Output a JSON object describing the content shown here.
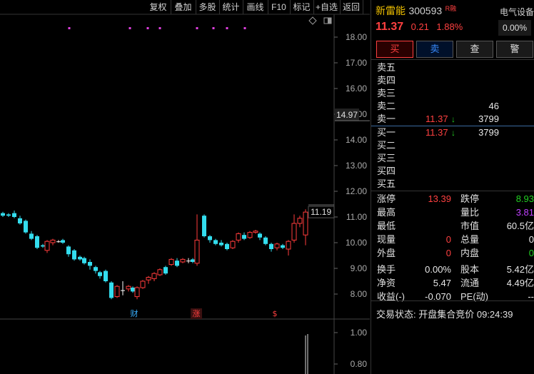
{
  "toolbar": {
    "items": [
      "复权",
      "叠加",
      "多股",
      "统计",
      "画线",
      "F10",
      "标记",
      "+自选",
      "返回"
    ]
  },
  "chart": {
    "price_ticks": [
      "18.00",
      "17.00",
      "16.00",
      "15.00",
      "14.00",
      "13.00",
      "12.00",
      "11.00",
      "10.00",
      "9.00",
      "8.00"
    ],
    "volume_ticks": [
      "1.00",
      "0.80"
    ],
    "current_price_tag": "14.97",
    "last_price_tag": "11.19",
    "event_labels": [
      "财",
      "涨",
      "$"
    ]
  },
  "stock": {
    "name": "新雷能",
    "code": "300593",
    "badge": "R融",
    "sector": "电气设备",
    "sector_change": "0.00%",
    "price": "11.37",
    "change": "0.21",
    "change_pct": "1.88%"
  },
  "actions": [
    "买",
    "卖",
    "查",
    "警"
  ],
  "order_book": {
    "asks": [
      {
        "label": "卖五",
        "price": "",
        "arrow": "",
        "vol": ""
      },
      {
        "label": "卖四",
        "price": "",
        "arrow": "",
        "vol": ""
      },
      {
        "label": "卖三",
        "price": "",
        "arrow": "",
        "vol": ""
      },
      {
        "label": "卖二",
        "price": "",
        "arrow": "",
        "vol": "46"
      },
      {
        "label": "卖一",
        "price": "11.37",
        "arrow": "↓",
        "vol": "3799"
      }
    ],
    "bids": [
      {
        "label": "买一",
        "price": "11.37",
        "arrow": "↓",
        "vol": "3799"
      },
      {
        "label": "买二",
        "price": "",
        "arrow": "",
        "vol": ""
      },
      {
        "label": "买三",
        "price": "",
        "arrow": "",
        "vol": ""
      },
      {
        "label": "买四",
        "price": "",
        "arrow": "",
        "vol": ""
      },
      {
        "label": "买五",
        "price": "",
        "arrow": "",
        "vol": ""
      }
    ]
  },
  "stats": [
    [
      {
        "l": "涨停",
        "v": "13.39",
        "c": "red"
      },
      {
        "l": "跌停",
        "v": "8.93",
        "c": "green"
      }
    ],
    [
      {
        "l": "最高",
        "v": "",
        "c": "white"
      },
      {
        "l": "量比",
        "v": "3.81",
        "c": "purple"
      }
    ],
    [
      {
        "l": "最低",
        "v": "",
        "c": "white"
      },
      {
        "l": "市值",
        "v": "60.5亿",
        "c": "white"
      }
    ],
    [
      {
        "l": "现量",
        "v": "0",
        "c": "red"
      },
      {
        "l": "总量",
        "v": "0",
        "c": "white"
      }
    ],
    [
      {
        "l": "外盘",
        "v": "0",
        "c": "red"
      },
      {
        "l": "内盘",
        "v": "0",
        "c": "green"
      }
    ],
    [
      {
        "l": "换手",
        "v": "0.00%",
        "c": "white"
      },
      {
        "l": "股本",
        "v": "5.42亿",
        "c": "white"
      }
    ],
    [
      {
        "l": "净资",
        "v": "5.47",
        "c": "white"
      },
      {
        "l": "流通",
        "v": "4.49亿",
        "c": "white"
      }
    ],
    [
      {
        "l": "收益(-)",
        "v": "-0.070",
        "c": "white"
      },
      {
        "l": "PE(动)",
        "v": "--",
        "c": "white"
      }
    ]
  ],
  "status": {
    "label": "交易状态:",
    "value": "开盘集合竞价 09:24:39"
  }
}
